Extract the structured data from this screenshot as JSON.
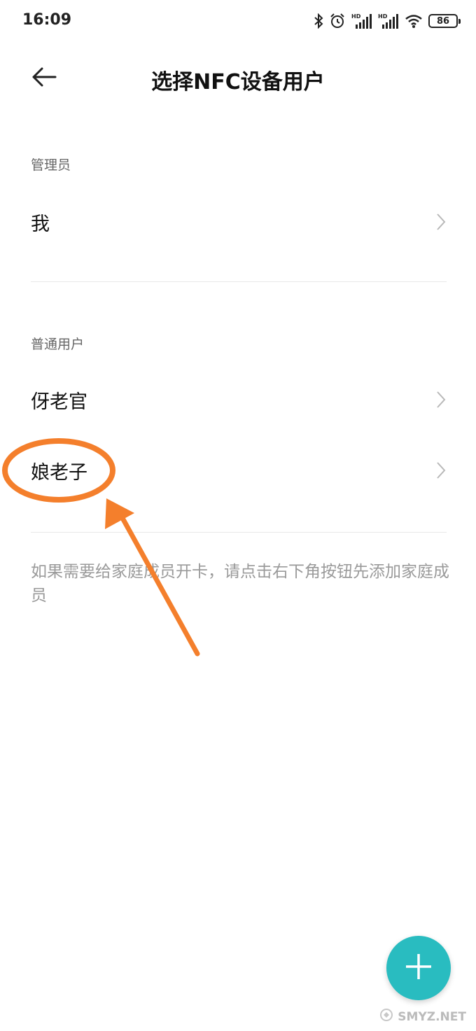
{
  "status_bar": {
    "time": "16:09",
    "battery": "86",
    "icons": [
      "bluetooth-icon",
      "alarm-icon",
      "hd-signal-icon",
      "hd-signal-icon",
      "wifi-icon",
      "battery-icon"
    ]
  },
  "header": {
    "title": "选择NFC设备用户",
    "back_icon": "arrow-left-icon"
  },
  "sections": [
    {
      "label": "管理员",
      "items": [
        {
          "label": "我"
        }
      ]
    },
    {
      "label": "普通用户",
      "items": [
        {
          "label": "伢老官"
        },
        {
          "label": "娘老子"
        }
      ]
    }
  ],
  "hint": "如果需要给家庭成员开卡，请点击右下角按钮先添加家庭成员",
  "fab": {
    "icon": "plus-icon",
    "color": "#29bcc0"
  },
  "annotation": {
    "color": "#f47f2c",
    "shapes": [
      "ellipse-highlight",
      "arrow"
    ]
  },
  "watermark": "SMYZ.NET"
}
